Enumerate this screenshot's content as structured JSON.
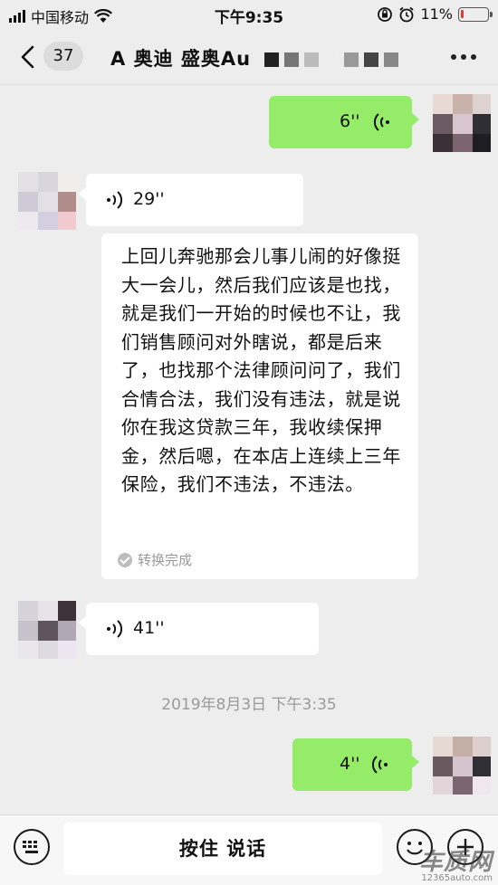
{
  "status_bar": {
    "carrier": "中国移动",
    "time": "下午9:35",
    "battery": "11%",
    "battery_level": 0.11
  },
  "header": {
    "unread_count": "37",
    "title": "A 奥迪 盛奥Au"
  },
  "messages": {
    "out_voice_1": {
      "duration": "6''"
    },
    "in_voice_1": {
      "duration": "29''"
    },
    "transcript": {
      "text": "上回儿奔驰那会儿事儿闹的好像挺大一会儿，然后我们应该是也找，就是我们一开始的时候也不让，我们销售顾问对外瞎说，都是后来了，也找那个法律顾问问了，我们合情合法，我们没有违法，就是说你在我这贷款三年，我收续保押金，然后嗯，在本店上连续上三年保险，我们不违法，不违法。",
      "status": "转换完成"
    },
    "in_voice_2": {
      "duration": "41''"
    },
    "timestamp": "2019年8月3日 下午3:35",
    "out_voice_2": {
      "duration": "4''"
    }
  },
  "input_bar": {
    "talk_label": "按住 说话"
  },
  "watermark": {
    "main": "车质网",
    "sub": "12365auto.com"
  },
  "colors": {
    "background": "#ededed",
    "outgoing_bubble": "#95ec69",
    "incoming_bubble": "#ffffff",
    "muted_text": "#9a9a9a"
  }
}
